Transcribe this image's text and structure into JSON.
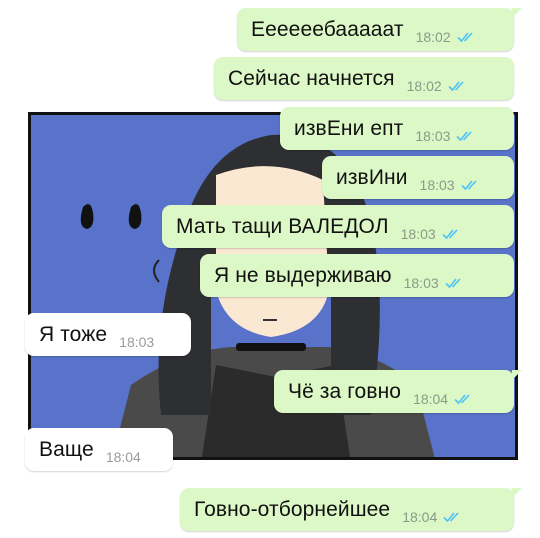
{
  "chat": {
    "messages": [
      {
        "direction": "outgoing",
        "text": "Еееееебааааат",
        "time": "18:02",
        "status": "read"
      },
      {
        "direction": "outgoing",
        "text": "Сейчас начнется",
        "time": "18:02",
        "status": "read"
      },
      {
        "direction": "outgoing",
        "text": "извЕни епт",
        "time": "18:03",
        "status": "read"
      },
      {
        "direction": "outgoing",
        "text": "извИни",
        "time": "18:03",
        "status": "read"
      },
      {
        "direction": "outgoing",
        "text": "Мать тащи ВАЛЕДОЛ",
        "time": "18:03",
        "status": "read"
      },
      {
        "direction": "outgoing",
        "text": "Я не выдерживаю",
        "time": "18:03",
        "status": "read"
      },
      {
        "direction": "incoming",
        "text": "Я тоже",
        "time": "18:03"
      },
      {
        "direction": "outgoing",
        "text": "Чё за говно",
        "time": "18:04",
        "status": "read"
      },
      {
        "direction": "incoming",
        "text": "Ваще",
        "time": "18:04"
      },
      {
        "direction": "outgoing",
        "text": "Говно-отборнейшее",
        "time": "18:04",
        "status": "read"
      }
    ]
  },
  "colors": {
    "outgoing_bubble": "#dcf8c6",
    "incoming_bubble": "#ffffff",
    "read_ticks": "#4fc3f7",
    "comic_background": "#5873c9"
  },
  "icons": {
    "read_status": "double-check-icon"
  }
}
